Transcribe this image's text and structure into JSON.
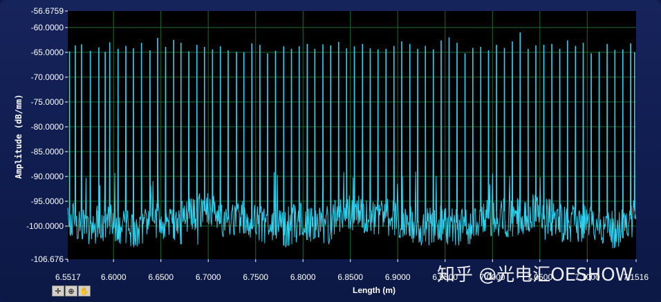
{
  "chart_data": {
    "type": "line",
    "xlabel": "Length (m)",
    "ylabel": "Amplitude (dB/mm)",
    "xlim": [
      6.5517,
      7.1516
    ],
    "ylim": [
      -106.676,
      -56.6759
    ],
    "x_ticks": [
      "6.5517",
      "6.6000",
      "6.6500",
      "6.7000",
      "6.7500",
      "6.8000",
      "6.8500",
      "6.9000",
      "6.9500",
      "7.0000",
      "7.0500",
      "7.1000",
      "7.1516"
    ],
    "y_ticks": [
      "-56.6759",
      "-60.0000",
      "-65.0000",
      "-70.0000",
      "-75.0000",
      "-80.0000",
      "-85.0000",
      "-90.0000",
      "-95.0000",
      "-100.0000",
      "-106.676"
    ],
    "grid": true,
    "series": [
      {
        "color": "#2fd3f0",
        "noise_floor_range": [
          -103,
          -95
        ],
        "peak_x": [
          6.5535,
          6.5597,
          6.5662,
          6.5755,
          6.5845,
          6.5912,
          6.596,
          6.6048,
          6.613,
          6.621,
          6.6295,
          6.6385,
          6.6465,
          6.655,
          6.6635,
          6.6712,
          6.6795,
          6.688,
          6.696,
          6.7045,
          6.7128,
          6.721,
          6.7298,
          6.7376,
          6.746,
          6.7545,
          6.7626,
          6.771,
          6.7796,
          6.7878,
          6.796,
          6.8045,
          6.8125,
          6.821,
          6.8292,
          6.8376,
          6.846,
          6.8542,
          6.8628,
          6.871,
          6.8792,
          6.8876,
          6.896,
          6.9042,
          6.9128,
          6.921,
          6.9292,
          6.9376,
          6.9458,
          6.9542,
          6.9626,
          6.971,
          6.9792,
          6.9876,
          6.9958,
          7.0042,
          7.0126,
          7.021,
          7.0292,
          7.0376,
          7.0458,
          7.0542,
          7.0626,
          7.071,
          7.0792,
          7.0876,
          7.0958,
          7.1042,
          7.1126,
          7.121,
          7.1292,
          7.1376,
          7.1458,
          7.15
        ],
        "peak_y": [
          -64.8,
          -63.6,
          -63.4,
          -64.7,
          -64.0,
          -64.9,
          -63.0,
          -64.3,
          -63.7,
          -64.2,
          -63.1,
          -64.6,
          -62.1,
          -63.9,
          -62.5,
          -63.1,
          -64.8,
          -63.5,
          -63.9,
          -64.4,
          -63.8,
          -64.6,
          -64.9,
          -65.0,
          -63.2,
          -63.5,
          -65.2,
          -64.7,
          -63.8,
          -64.3,
          -63.8,
          -63.3,
          -64.3,
          -63.4,
          -63.6,
          -62.9,
          -64.2,
          -63.8,
          -63.3,
          -64.2,
          -64.4,
          -64.3,
          -63.7,
          -62.8,
          -63.3,
          -64.3,
          -63.7,
          -64.4,
          -62.6,
          -62.0,
          -63.1,
          -65.2,
          -64.1,
          -63.9,
          -64.6,
          -63.5,
          -64.1,
          -62.8,
          -61.0,
          -64.3,
          -63.6,
          -63.5,
          -63.3,
          -64.3,
          -62.6,
          -63.7,
          -63.1,
          -65.2,
          -64.9,
          -63.3,
          -64.5,
          -64.4,
          -63.2,
          -65.0
        ]
      }
    ]
  },
  "toolbar": {
    "buttons": [
      {
        "name": "cursor-move-tool",
        "glyph": "✛"
      },
      {
        "name": "zoom-tool",
        "glyph": "⊕"
      },
      {
        "name": "pan-tool",
        "glyph": "✋"
      }
    ]
  },
  "watermark": {
    "text": "知乎 @光电汇OESHOW"
  }
}
